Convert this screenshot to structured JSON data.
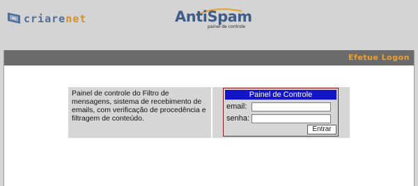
{
  "header": {
    "brand_left": {
      "name_part1": "criare",
      "name_part2": "net"
    },
    "brand_right": {
      "title_part1": "Anti",
      "title_part2": "Spam",
      "subtitle": "painel de controle"
    }
  },
  "main": {
    "title_bar": "Efetue Logon",
    "description": "Painel de controle do Filtro de mensagens, sistema de recebimento de emails, com verificação de procedência e filtragem de conteúdo.",
    "login": {
      "header": "Painel de Controle",
      "email_label": "email:",
      "email_value": "",
      "password_label": "senha:",
      "password_value": "",
      "submit_label": "Entrar"
    }
  },
  "colors": {
    "page_bg": "#d4d4d4",
    "title_bar_bg": "#6b6b6b",
    "title_bar_text": "#f0a030",
    "login_header_bg": "#1414c8",
    "login_border": "#8b1a1a",
    "brand_blue": "#4f6d95",
    "brand_orange": "#d98f2a"
  }
}
